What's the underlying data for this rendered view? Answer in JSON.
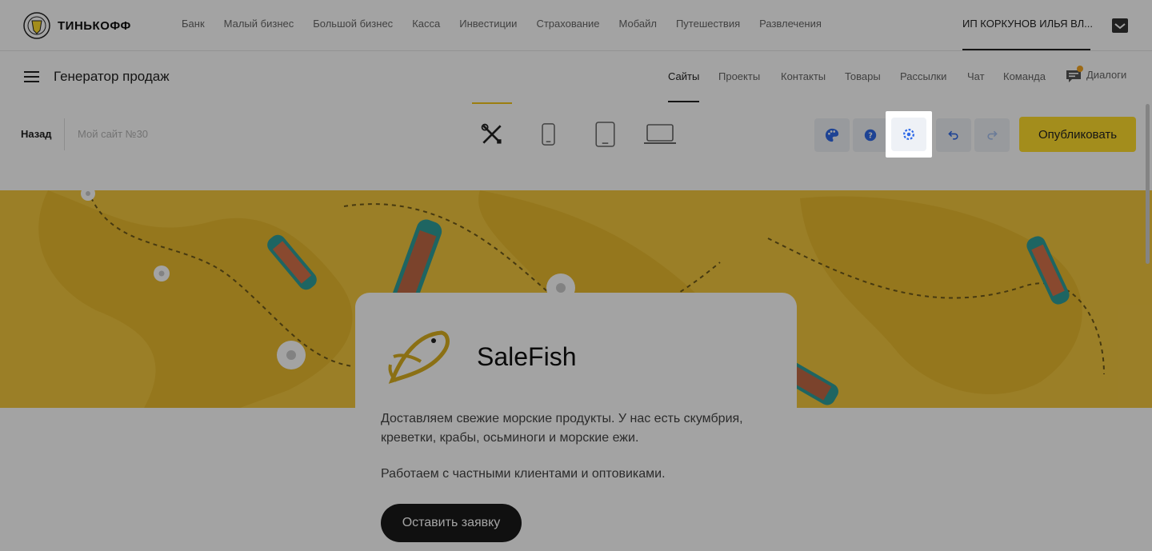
{
  "brand": {
    "logo_text": "ТИНЬКОФФ"
  },
  "top_nav": [
    "Банк",
    "Малый бизнес",
    "Большой бизнес",
    "Касса",
    "Инвестиции",
    "Страхование",
    "Мобайл",
    "Путешествия",
    "Развлечения"
  ],
  "account": {
    "name": "ИП КОРКУНОВ ИЛЬЯ ВЛ..."
  },
  "section": {
    "title": "Генератор продаж",
    "nav": [
      "Сайты",
      "Проекты",
      "Контакты",
      "Товары",
      "Рассылки",
      "Чат",
      "Команда"
    ],
    "active": "Сайты",
    "dialogs_label": "Диалоги"
  },
  "editor": {
    "back_label": "Назад",
    "site_name_placeholder": "Мой сайт №30",
    "devices": [
      "tools-icon",
      "phone-icon",
      "tablet-icon",
      "laptop-icon"
    ],
    "buttons": [
      "palette-icon",
      "help-icon",
      "settings-icon",
      "undo-icon",
      "redo-icon"
    ],
    "publish_label": "Опубликовать"
  },
  "card": {
    "brand_name": "SaleFish",
    "text1": "Доставляем свежие морские продукты. У нас есть скумбрия, креветки, крабы, осьминоги и морские ежи.",
    "text2": "Работаем с частными клиентами и оптовиками.",
    "button_label": "Оставить заявку"
  },
  "colors": {
    "accent_yellow": "#ffdd2d",
    "hero_bg": "#f3c73e",
    "icon_blue": "#2f6ae8"
  }
}
